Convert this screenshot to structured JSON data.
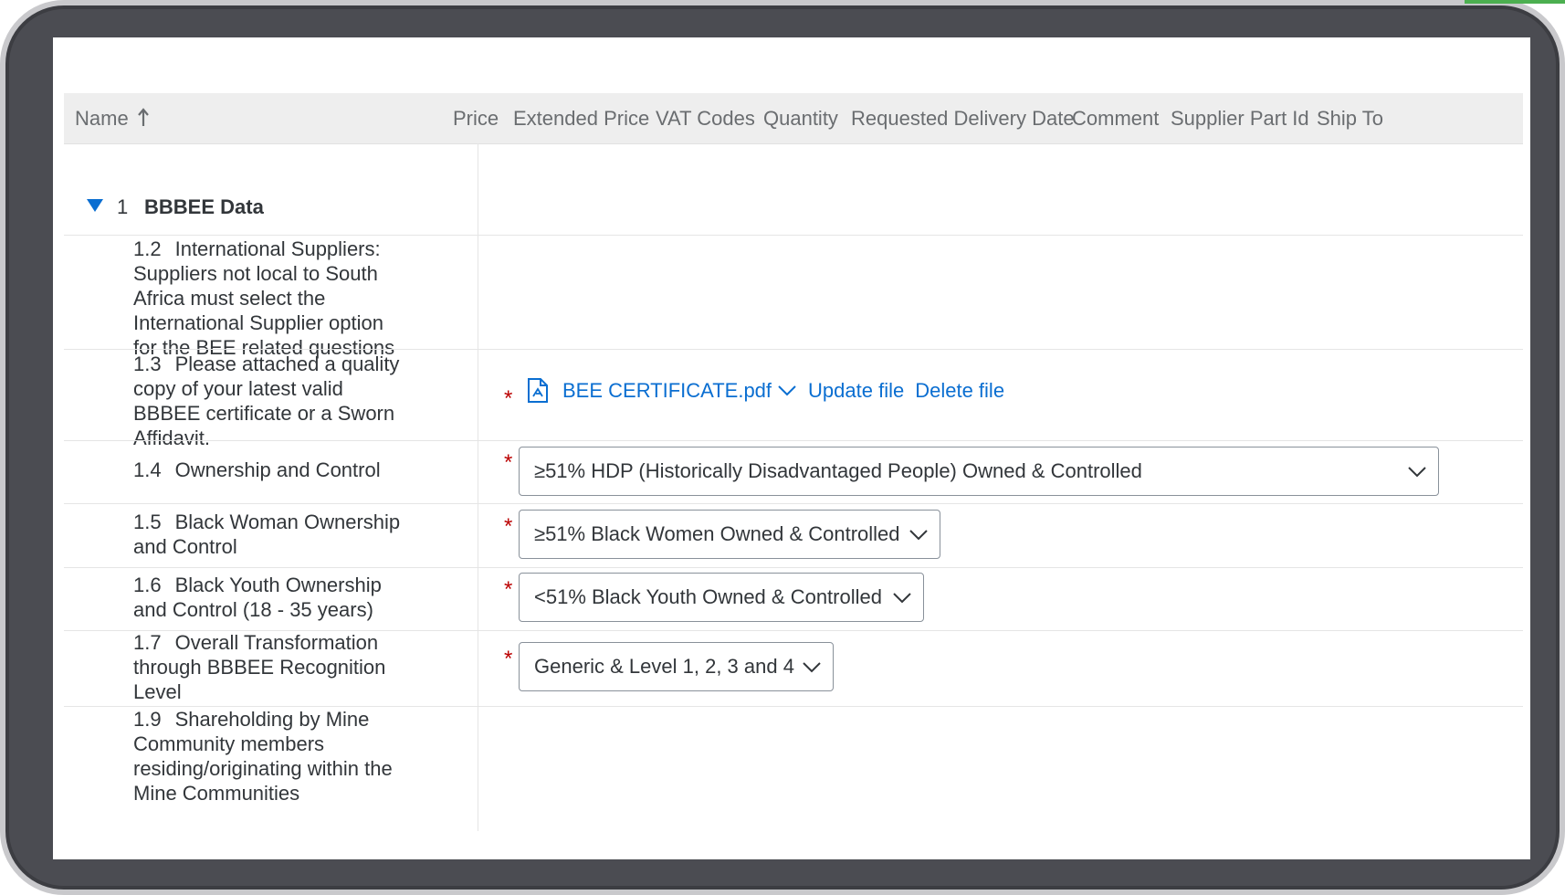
{
  "table": {
    "name_header": "Name",
    "columns": [
      "Price",
      "Extended Price",
      "VAT Codes",
      "Quantity",
      "Requested Delivery Date",
      "Comment",
      "Supplier Part Id",
      "Ship To"
    ]
  },
  "group": {
    "number": "1",
    "title": "BBBEE Data"
  },
  "items": [
    {
      "number": "1.2",
      "label": "International Suppliers: Suppliers not local to South Africa must select the International Supplier option for the BEE related questions"
    },
    {
      "number": "1.3",
      "label": "Please attached a quality copy of your latest valid BBBEE certificate or a Sworn Affidavit."
    },
    {
      "number": "1.4",
      "label": "Ownership and Control"
    },
    {
      "number": "1.5",
      "label": "Black Woman Ownership and Control"
    },
    {
      "number": "1.6",
      "label": "Black Youth Ownership and Control (18 - 35 years)"
    },
    {
      "number": "1.7",
      "label": "Overall Transformation through BBBEE Recognition Level"
    },
    {
      "number": "1.9",
      "label": "Shareholding by Mine Community members residing/originating within the Mine Communities"
    }
  ],
  "attachment": {
    "file_name": "BEE CERTIFICATE.pdf",
    "update_label": "Update file",
    "delete_label": "Delete file"
  },
  "selects": {
    "ownership": "≥51% HDP (Historically Disadvantaged People) Owned & Controlled",
    "black_woman": "≥51% Black Women Owned & Controlled",
    "black_youth": "<51% Black Youth Owned & Controlled",
    "recognition": "Generic & Level 1, 2, 3 and 4"
  },
  "required_marker": "*",
  "colors": {
    "link": "#0a6ed1",
    "required": "#bb0000",
    "header_bg": "#eeeeee",
    "text": "#32363a"
  }
}
